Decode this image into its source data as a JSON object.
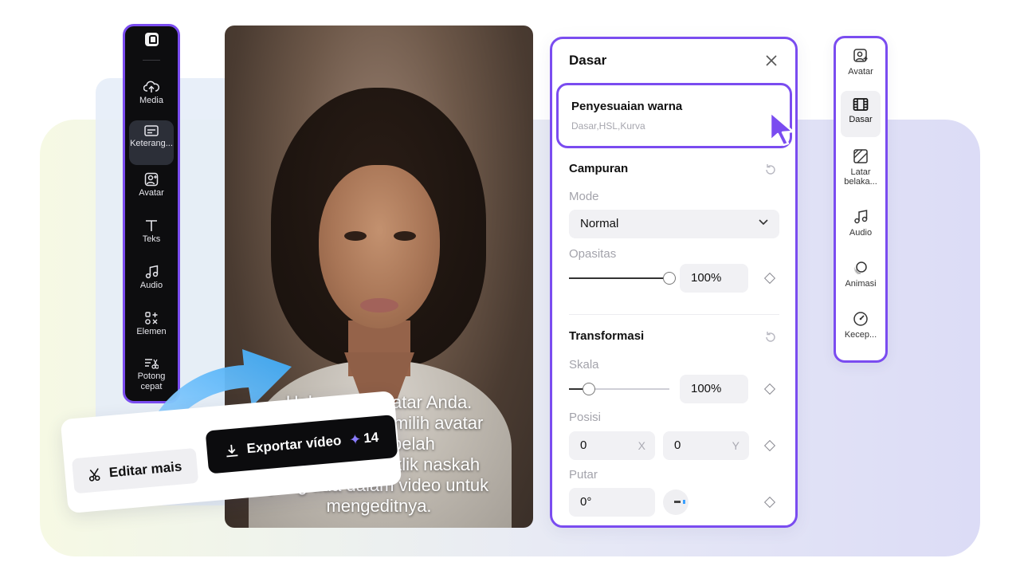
{
  "left_sidebar": {
    "items": [
      {
        "label": "Media",
        "icon": "cloud-upload-icon"
      },
      {
        "label": "Keterang...",
        "icon": "captions-icon",
        "active": true
      },
      {
        "label": "Avatar",
        "icon": "avatar-icon"
      },
      {
        "label": "Teks",
        "icon": "text-icon"
      },
      {
        "label": "Audio",
        "icon": "music-note-icon"
      },
      {
        "label": "Elemen",
        "icon": "elements-icon"
      },
      {
        "label": "Potong",
        "label2": "cepat",
        "icon": "quick-cut-icon"
      }
    ]
  },
  "video": {
    "caption_lines": [
      "Halo, saya avatar Anda.",
      "Anda dapat memilih avatar",
      "lain di sebelah",
      "kiri, atau mengklik naskah",
      "yang ada dalam video untuk",
      "mengeditnya."
    ]
  },
  "buttons": {
    "edit_label": "Editar mais",
    "export_label": "Exportar vídeo",
    "export_credits": "14"
  },
  "panel": {
    "title": "Dasar",
    "color_adjust": {
      "title": "Penyesuaian warna",
      "subtitle": "Dasar,HSL,Kurva"
    },
    "blend": {
      "title": "Campuran",
      "mode_label": "Mode",
      "mode_value": "Normal",
      "opacity_label": "Opasitas",
      "opacity_value": "100%",
      "opacity_level": 1.0
    },
    "transform": {
      "title": "Transformasi",
      "scale_label": "Skala",
      "scale_value": "100%",
      "position_label": "Posisi",
      "pos_x": "0",
      "pos_x_axis": "X",
      "pos_y": "0",
      "pos_y_axis": "Y",
      "rotate_label": "Putar",
      "rotate_value": "0°"
    }
  },
  "right_sidebar": {
    "items": [
      {
        "label": "Avatar",
        "icon": "avatar-icon"
      },
      {
        "label": "Dasar",
        "icon": "film-icon",
        "active": true
      },
      {
        "label": "Latar",
        "label2": "belaka...",
        "icon": "background-icon"
      },
      {
        "label": "Audio",
        "icon": "music-note-icon"
      },
      {
        "label": "Animasi",
        "icon": "animation-icon"
      },
      {
        "label": "Kecep...",
        "icon": "speed-icon"
      }
    ]
  },
  "colors": {
    "accent": "#7a4cf0",
    "sidebar_bg": "#0d0d0f",
    "export_button": "#0c0c0e"
  }
}
